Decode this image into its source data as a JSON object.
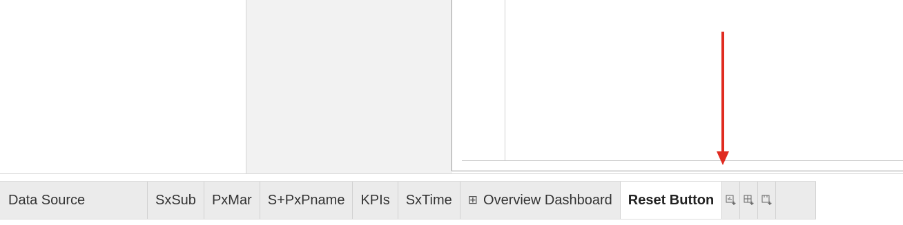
{
  "tabs": {
    "data_source": "Data Source",
    "sheets": [
      {
        "label": "SxSub"
      },
      {
        "label": "PxMar"
      },
      {
        "label": "S+PxPname"
      },
      {
        "label": "KPIs"
      },
      {
        "label": "SxTime"
      }
    ],
    "dashboard": {
      "icon": "⊞",
      "label": "Overview Dashboard"
    },
    "active": {
      "label": "Reset Button"
    },
    "new_sheet_icon": "new-worksheet-icon",
    "new_dashboard_icon": "new-dashboard-icon",
    "new_story_icon": "new-story-icon"
  },
  "annotation": {
    "arrow_color": "#e02b20"
  },
  "colors": {
    "tabstrip_bg": "#ebebeb",
    "active_tab_bg": "#ffffff",
    "middle_pane_bg": "#f2f2f2"
  }
}
